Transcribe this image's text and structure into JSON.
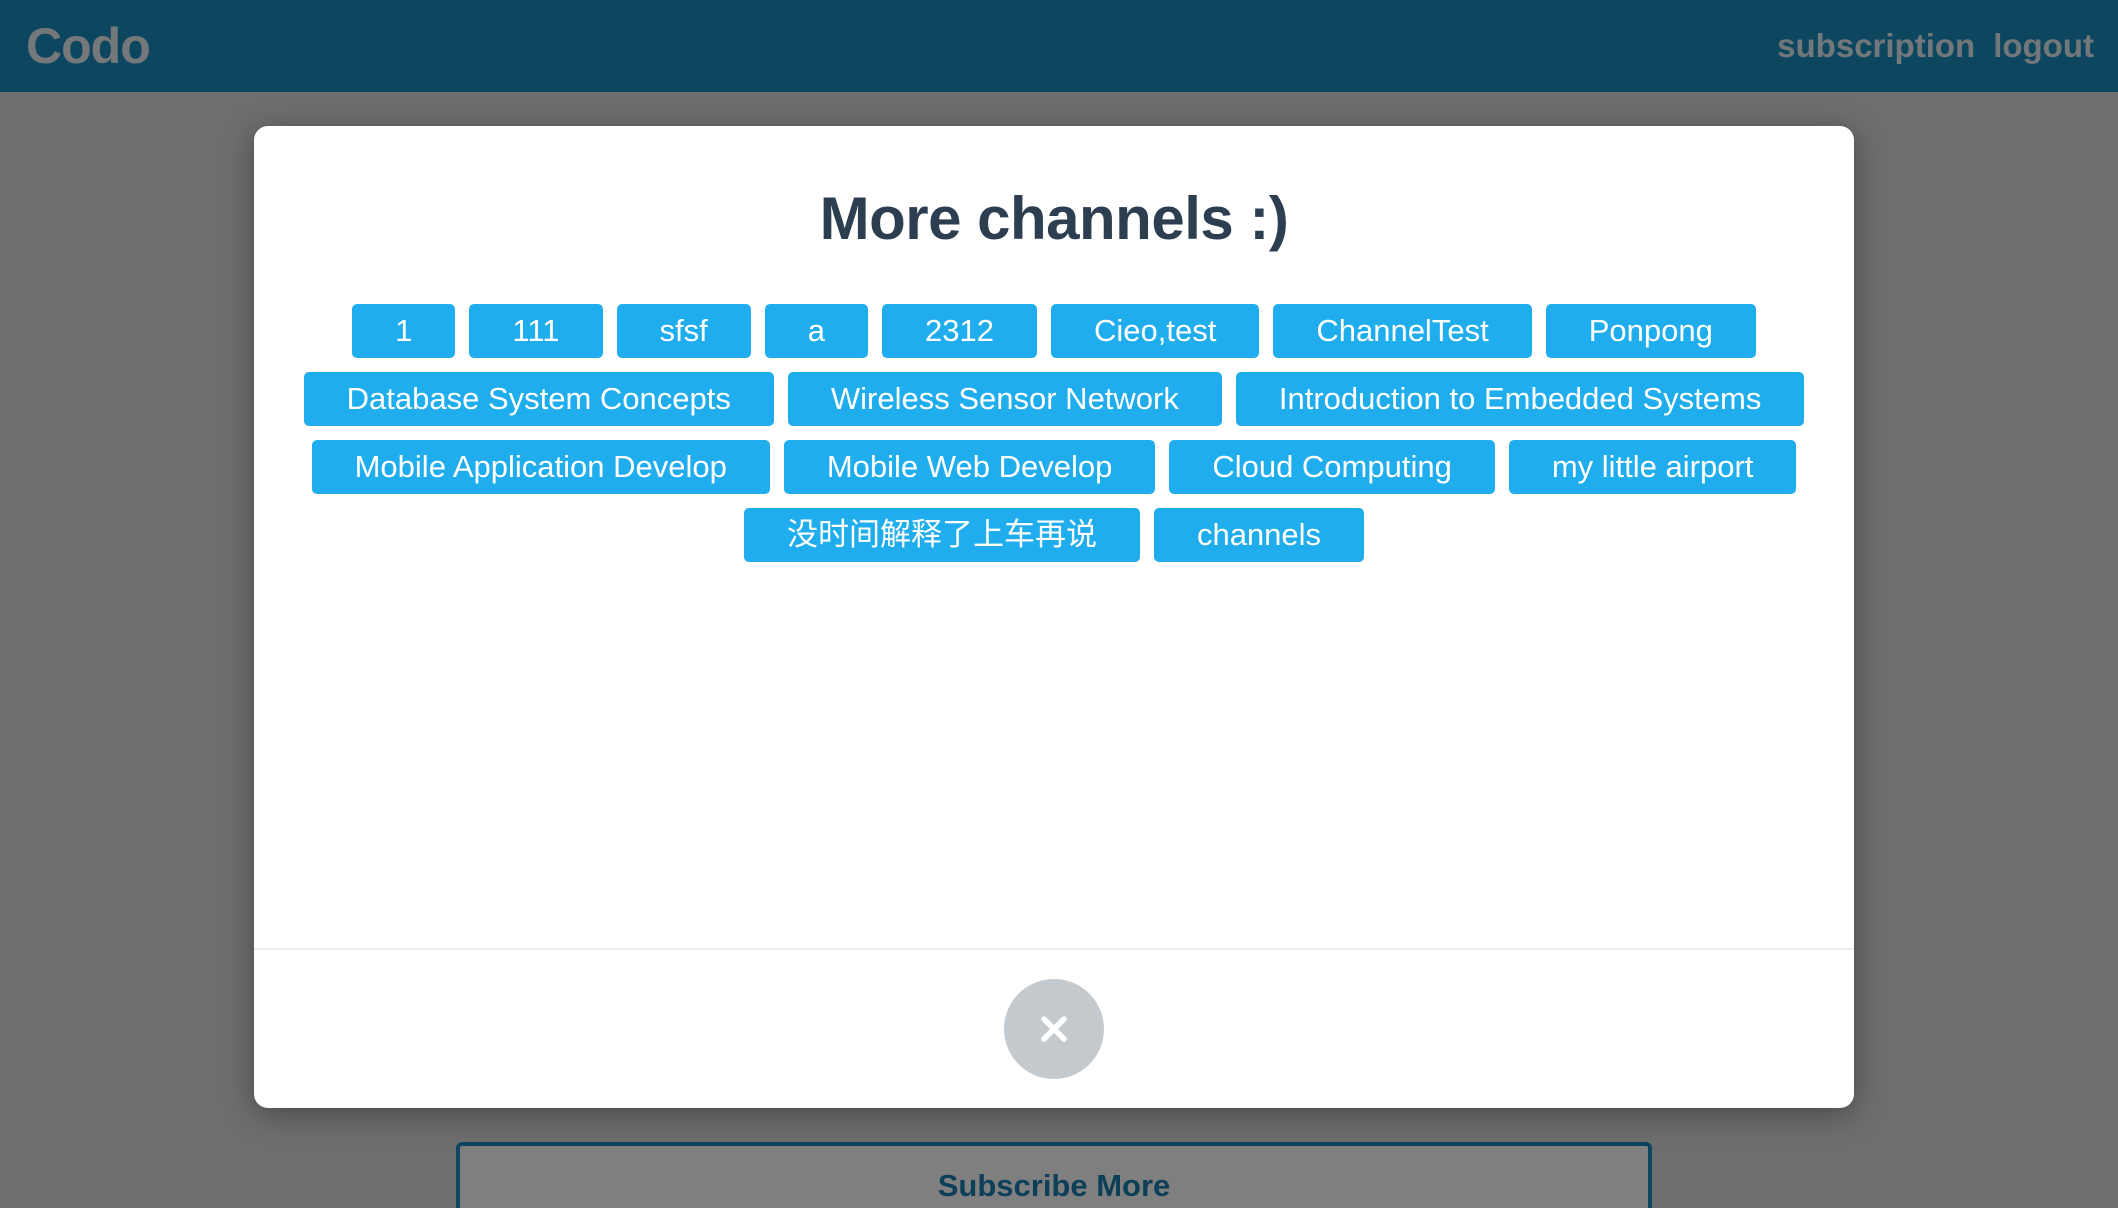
{
  "navbar": {
    "brand": "Codo",
    "links": [
      "subscription",
      "logout"
    ]
  },
  "page": {
    "subscribe_more_label": "Subscribe More"
  },
  "modal": {
    "title": "More channels :)",
    "channels": [
      "1",
      "111",
      "sfsf",
      "a",
      "2312",
      "Cieo,test",
      "ChannelTest",
      "Ponpong",
      "Database System Concepts",
      "Wireless Sensor Network",
      "Introduction to Embedded Systems",
      "Mobile Application Develop",
      "Mobile Web Develop",
      "Cloud Computing",
      "my little airport",
      "没时间解释了上车再说",
      "channels"
    ],
    "close_icon": "close-icon"
  },
  "colors": {
    "navbar": "#1a8cbf",
    "chip": "#1fadee",
    "title": "#2c3e50",
    "close_button": "#c4c9cd"
  }
}
